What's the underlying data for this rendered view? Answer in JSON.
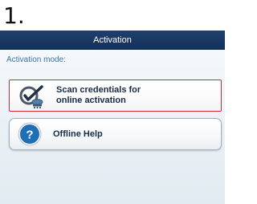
{
  "step": {
    "number": "1."
  },
  "header": {
    "title": "Activation"
  },
  "main": {
    "mode_label": "Activation mode:",
    "options": [
      {
        "label": "Scan credentials for\nonline activation",
        "icon": "scan-credentials-icon",
        "highlighted": true,
        "highlight_color": "#d8262c"
      },
      {
        "label": "Offline Help",
        "icon": "help-icon",
        "highlighted": false
      }
    ]
  },
  "colors": {
    "titlebar": "#1a3863",
    "mode_label": "#3e74a8",
    "option_text": "#162c47",
    "help_icon": "#1f6fb8"
  }
}
